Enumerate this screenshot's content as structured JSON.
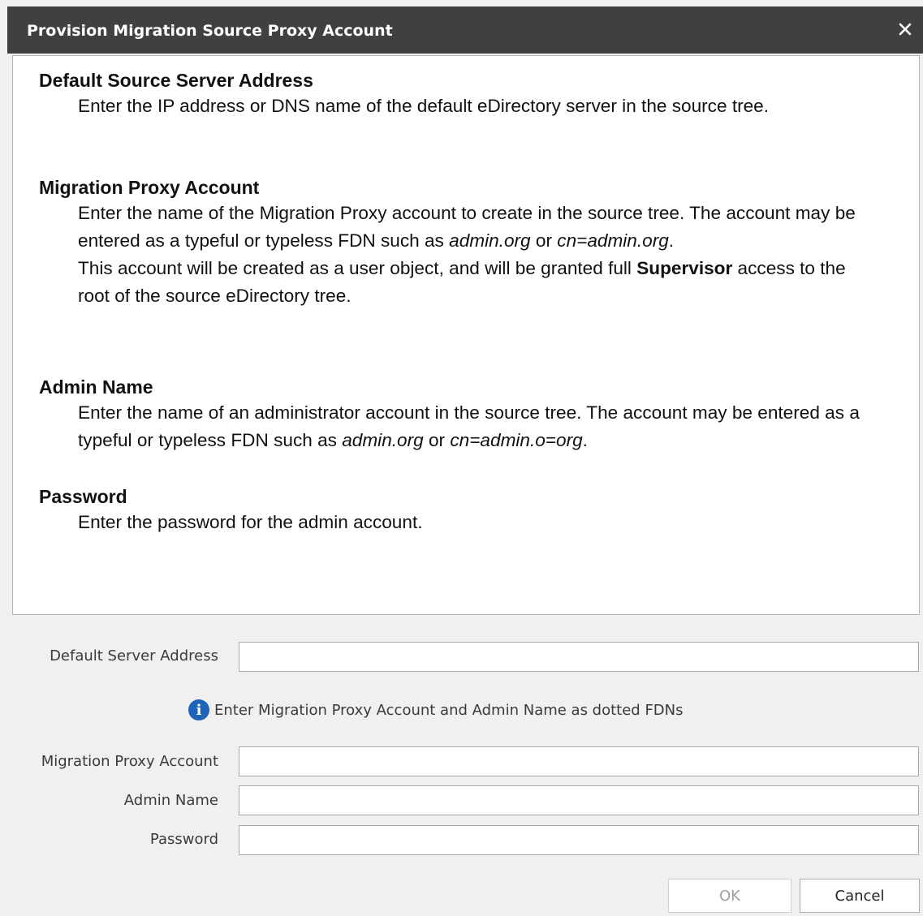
{
  "window": {
    "title": "Provision Migration Source Proxy Account",
    "close_icon": "close-icon"
  },
  "help": {
    "sections": [
      {
        "heading": "Default Source Server Address",
        "body": "Enter the IP address or DNS name of the default eDirectory server in the source tree."
      },
      {
        "heading": "Migration Proxy Account",
        "body_1": "Enter the name of the Migration Proxy account to create in the source tree.  The account may be entered as a typeful or typeless FDN such as ",
        "body_italic_1": "admin.org",
        "body_2": " or ",
        "body_italic_2": "cn=admin.org",
        "body_3": ".",
        "body_4": "This account will be created as a user object, and will be granted full ",
        "body_bold": "Supervisor",
        "body_5": " access to the root of the source eDirectory tree."
      },
      {
        "heading": "Admin Name",
        "body_1": "Enter the name of an administrator account in the source tree.  The account may be entered as a typeful or typeless FDN such as ",
        "body_italic_1": "admin.org",
        "body_2": " or ",
        "body_italic_2": "cn=admin.o=org",
        "body_3": "."
      },
      {
        "heading": "Password",
        "body": "Enter the password for the admin account."
      }
    ]
  },
  "form": {
    "default_server_address_label": "Default Server Address",
    "default_server_address_value": "",
    "info_icon": "info-icon",
    "info_text": "Enter Migration Proxy Account and Admin Name as dotted FDNs",
    "migration_proxy_account_label": "Migration Proxy Account",
    "migration_proxy_account_value": "",
    "admin_name_label": "Admin Name",
    "admin_name_value": "",
    "password_label": "Password",
    "password_value": ""
  },
  "buttons": {
    "ok_label": "OK",
    "cancel_label": "Cancel"
  }
}
